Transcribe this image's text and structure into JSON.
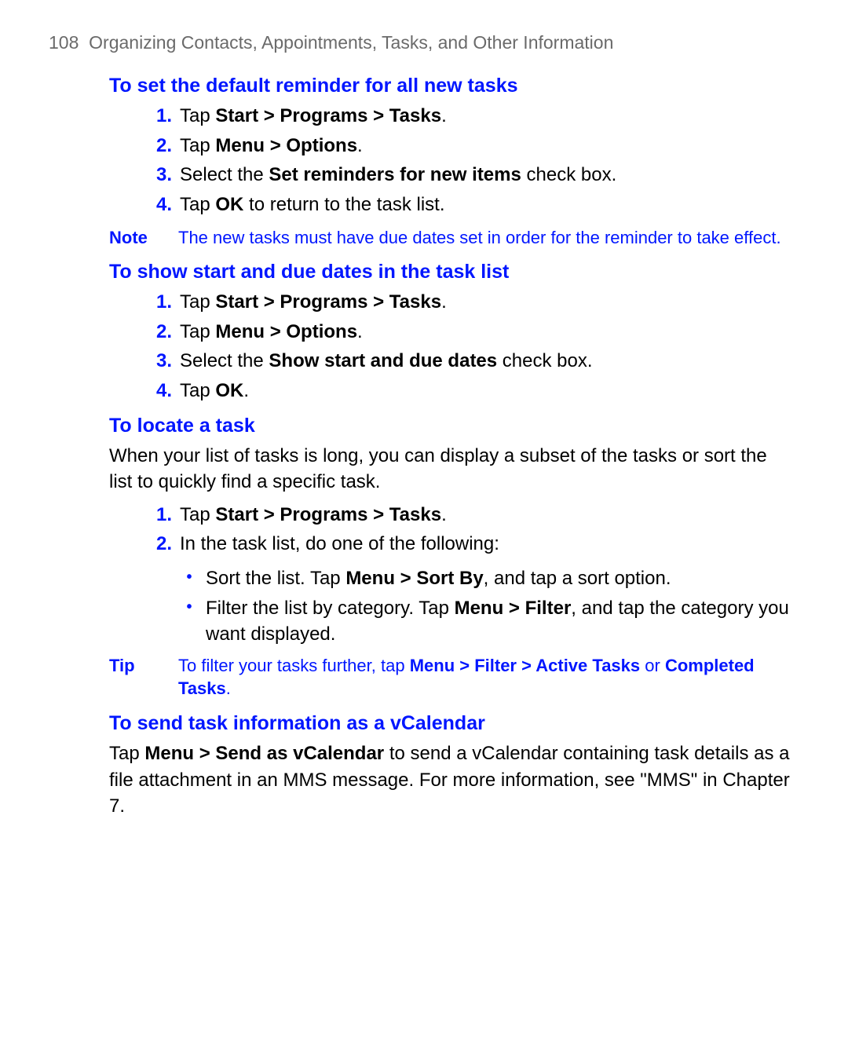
{
  "header": {
    "page_number": "108",
    "chapter_title": "Organizing Contacts, Appointments, Tasks, and Other Information"
  },
  "section1": {
    "heading": "To set the default reminder for all new tasks",
    "steps": [
      {
        "n": "1.",
        "pre": "Tap ",
        "bold": "Start > Programs > Tasks",
        "post": "."
      },
      {
        "n": "2.",
        "pre": "Tap ",
        "bold": "Menu > Options",
        "post": "."
      },
      {
        "n": "3.",
        "pre": "Select the ",
        "bold": "Set reminders for new items",
        "post": " check box."
      },
      {
        "n": "4.",
        "pre": "Tap ",
        "bold": "OK",
        "post": " to return to the task list."
      }
    ],
    "note_label": "Note",
    "note_text": "The new tasks must have due dates set in order for the reminder to take effect."
  },
  "section2": {
    "heading": "To show start and due dates in the task list",
    "steps": [
      {
        "n": "1.",
        "pre": "Tap ",
        "bold": "Start > Programs > Tasks",
        "post": "."
      },
      {
        "n": "2.",
        "pre": "Tap ",
        "bold": "Menu > Options",
        "post": "."
      },
      {
        "n": "3.",
        "pre": "Select the ",
        "bold": "Show start and due dates",
        "post": " check box."
      },
      {
        "n": "4.",
        "pre": "Tap ",
        "bold": "OK",
        "post": "."
      }
    ]
  },
  "section3": {
    "heading": "To locate a task",
    "intro": "When your list of tasks is long, you can display a subset of the tasks or sort the list to quickly find a specific task.",
    "steps": [
      {
        "n": "1.",
        "pre": "Tap ",
        "bold": "Start > Programs > Tasks",
        "post": "."
      },
      {
        "n": "2.",
        "pre": "In the task list, do one of the following:",
        "bold": "",
        "post": ""
      }
    ],
    "bullets": [
      {
        "pre": "Sort the list. Tap ",
        "bold": "Menu > Sort By",
        "post": ", and tap a sort option."
      },
      {
        "pre": "Filter the list by category. Tap ",
        "bold": "Menu > Filter",
        "post": ", and tap the category you want displayed."
      }
    ],
    "tip_label": "Tip",
    "tip_pre": "To filter your tasks further, tap ",
    "tip_bold1": "Menu > Filter > Active Tasks",
    "tip_mid": " or ",
    "tip_bold2": "Completed Tasks",
    "tip_post": "."
  },
  "section4": {
    "heading": "To send task information as a vCalendar",
    "para_pre": "Tap ",
    "para_bold": "Menu > Send as vCalendar",
    "para_post": " to send a vCalendar containing task details as a file attachment in an MMS message. For more information, see \"MMS\" in Chapter 7."
  }
}
